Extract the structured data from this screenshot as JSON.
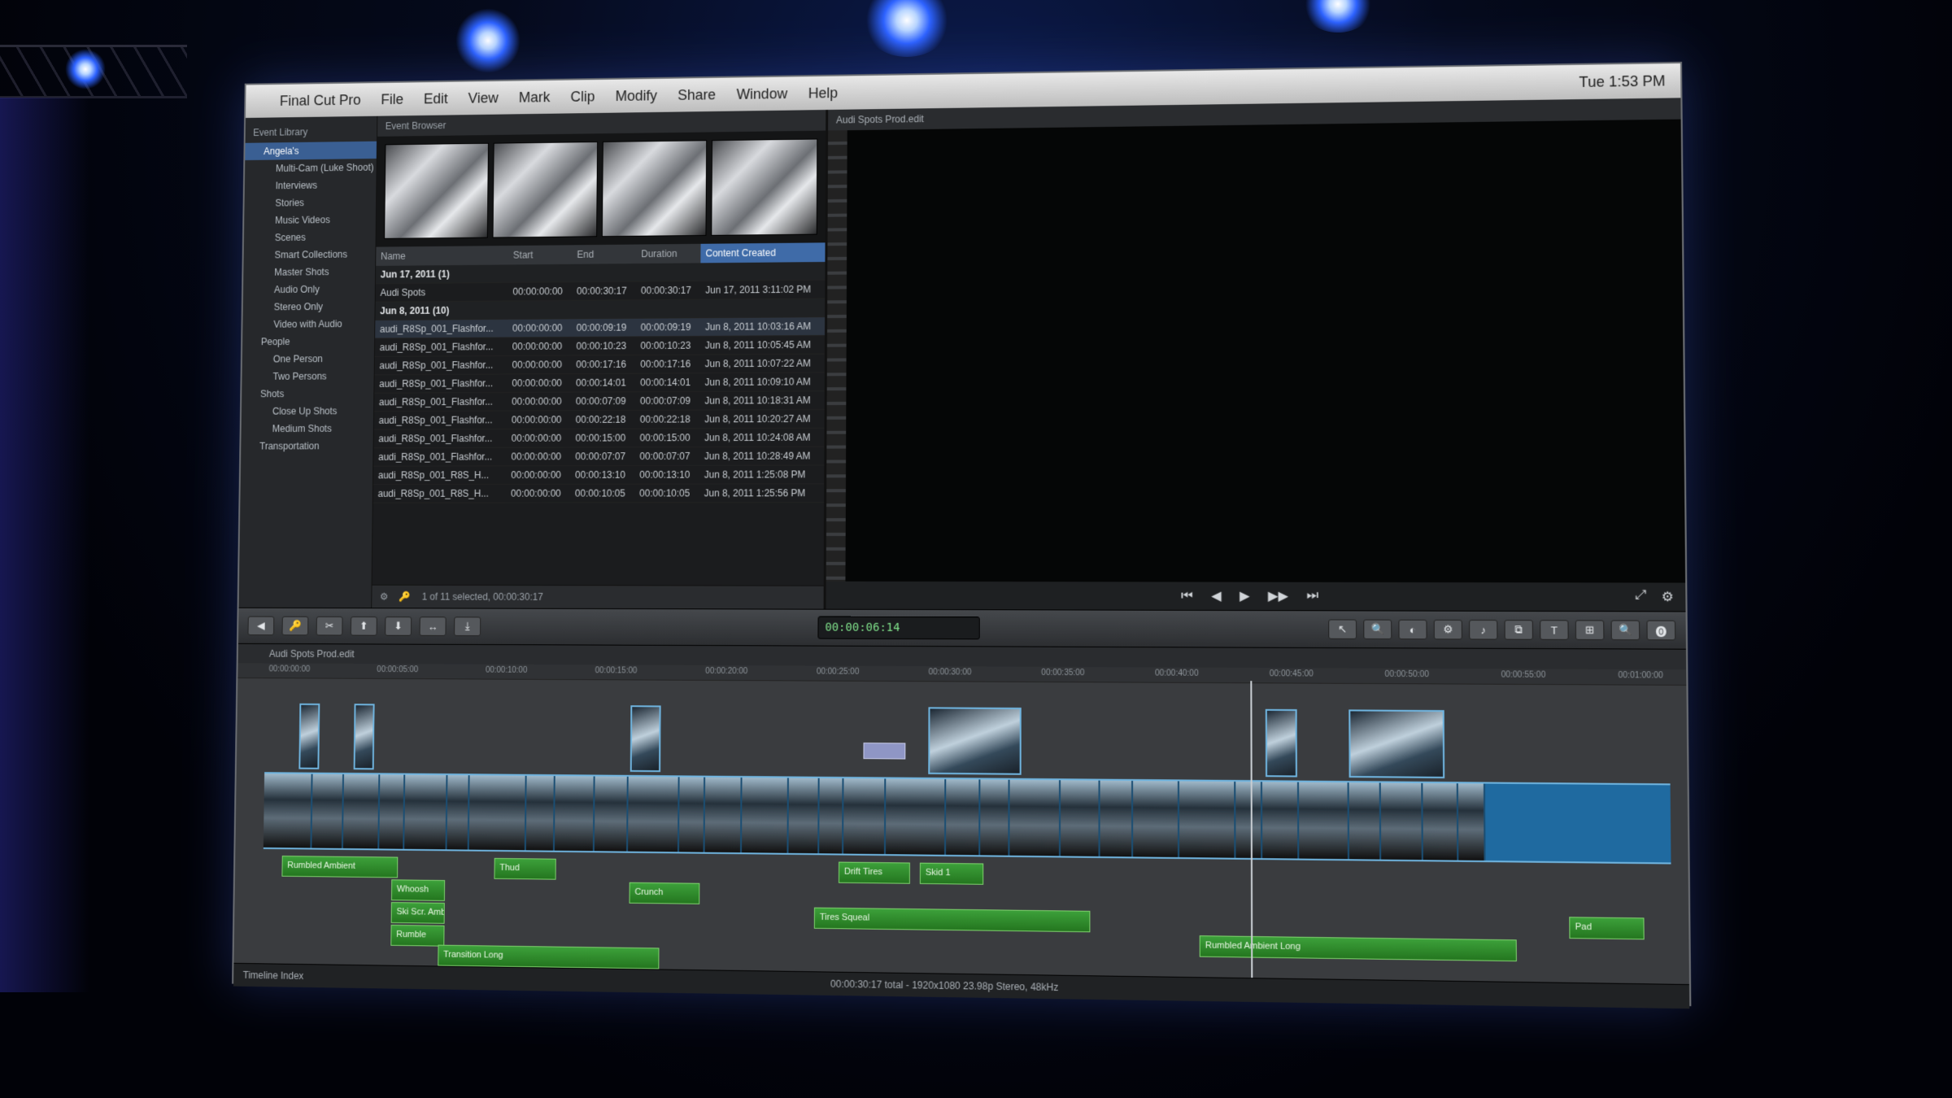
{
  "app": {
    "menu": [
      "Final Cut Pro",
      "File",
      "Edit",
      "View",
      "Mark",
      "Clip",
      "Modify",
      "Share",
      "Window",
      "Help"
    ],
    "clock": "Tue 1:53 PM"
  },
  "library": {
    "header": "Event Library",
    "items": [
      {
        "label": "Angela's",
        "indent": false,
        "selected": true
      },
      {
        "label": "Multi-Cam (Luke Shoot)",
        "indent": true
      },
      {
        "label": "Interviews",
        "indent": true
      },
      {
        "label": "Stories",
        "indent": true
      },
      {
        "label": "Music Videos",
        "indent": true
      },
      {
        "label": "Scenes",
        "indent": true
      },
      {
        "label": "Smart Collections",
        "indent": true
      },
      {
        "label": "Master Shots",
        "indent": true
      },
      {
        "label": "Audio Only",
        "indent": true
      },
      {
        "label": "Stereo Only",
        "indent": true
      },
      {
        "label": "Video with Audio",
        "indent": true
      },
      {
        "label": "People",
        "indent": false
      },
      {
        "label": "One Person",
        "indent": true
      },
      {
        "label": "Two Persons",
        "indent": true
      },
      {
        "label": "Shots",
        "indent": false
      },
      {
        "label": "Close Up Shots",
        "indent": true
      },
      {
        "label": "Medium Shots",
        "indent": true
      },
      {
        "label": "Transportation",
        "indent": false
      }
    ]
  },
  "browser": {
    "header": "Event Browser",
    "columns": [
      "Name",
      "Start",
      "End",
      "Duration",
      "Content Created"
    ],
    "groups": [
      {
        "label": "Jun 17, 2011 (1)",
        "rows": [
          [
            "Audi Spots",
            "00:00:00:00",
            "00:00:30:17",
            "00:00:30:17",
            "Jun 17, 2011 3:11:02 PM"
          ]
        ]
      },
      {
        "label": "Jun 8, 2011 (10)",
        "rows": [
          [
            "audi_R8Sp_001_Flashfor...",
            "00:00:00:00",
            "00:00:09:19",
            "00:00:09:19",
            "Jun 8, 2011 10:03:16 AM"
          ],
          [
            "audi_R8Sp_001_Flashfor...",
            "00:00:00:00",
            "00:00:10:23",
            "00:00:10:23",
            "Jun 8, 2011 10:05:45 AM"
          ],
          [
            "audi_R8Sp_001_Flashfor...",
            "00:00:00:00",
            "00:00:17:16",
            "00:00:17:16",
            "Jun 8, 2011 10:07:22 AM"
          ],
          [
            "audi_R8Sp_001_Flashfor...",
            "00:00:00:00",
            "00:00:14:01",
            "00:00:14:01",
            "Jun 8, 2011 10:09:10 AM"
          ],
          [
            "audi_R8Sp_001_Flashfor...",
            "00:00:00:00",
            "00:00:07:09",
            "00:00:07:09",
            "Jun 8, 2011 10:18:31 AM"
          ],
          [
            "audi_R8Sp_001_Flashfor...",
            "00:00:00:00",
            "00:00:22:18",
            "00:00:22:18",
            "Jun 8, 2011 10:20:27 AM"
          ],
          [
            "audi_R8Sp_001_Flashfor...",
            "00:00:00:00",
            "00:00:15:00",
            "00:00:15:00",
            "Jun 8, 2011 10:24:08 AM"
          ],
          [
            "audi_R8Sp_001_Flashfor...",
            "00:00:00:00",
            "00:00:07:07",
            "00:00:07:07",
            "Jun 8, 2011 10:28:49 AM"
          ],
          [
            "audi_R8Sp_001_R8S_H...",
            "00:00:00:00",
            "00:00:13:10",
            "00:00:13:10",
            "Jun 8, 2011 1:25:08 PM"
          ],
          [
            "audi_R8Sp_001_R8S_H...",
            "00:00:00:00",
            "00:00:10:05",
            "00:00:10:05",
            "Jun 8, 2011 1:25:56 PM"
          ]
        ]
      }
    ],
    "footer": "1 of 11 selected, 00:00:30:17"
  },
  "viewer": {
    "title": "Audi Spots Prod.edit",
    "controls": [
      "⏮",
      "◀",
      "▶",
      "▶▶",
      "⏭"
    ],
    "right_controls": [
      "⤢",
      "⚙"
    ]
  },
  "toolbar": {
    "left_buttons": [
      "◀",
      "🔑",
      "✂",
      "⬆",
      "⬇",
      "↔",
      "⤓"
    ],
    "timecode": "00:00:06:14",
    "right_buttons": [
      "↖",
      "🔍",
      "◐",
      "⚙",
      "♪",
      "⧉",
      "T",
      "⊞",
      "🔍",
      "⓿"
    ]
  },
  "timeline": {
    "title": "Audi Spots Prod.edit",
    "ticks": [
      "00:00:00:00",
      "00:00:05:00",
      "00:00:10:00",
      "00:00:15:00",
      "00:00:20:00",
      "00:00:25:00",
      "00:00:30:00",
      "00:00:35:00",
      "00:00:40:00",
      "00:00:45:00",
      "00:00:50:00",
      "00:00:55:00",
      "00:01:00:00"
    ],
    "audio_clips": [
      "Rumbled Ambient",
      "Thud",
      "Whoosh",
      "Crunch",
      "Tires Squeal",
      "Drift Tires",
      "Skid 1",
      "Ski Scr. Ambient Long",
      "Rumble",
      "Rumbled Ambient Long",
      "Transition Long",
      "Pad"
    ]
  },
  "status": {
    "center": "00:00:30:17 total - 1920x1080 23.98p Stereo, 48kHz",
    "left": "Timeline Index"
  }
}
